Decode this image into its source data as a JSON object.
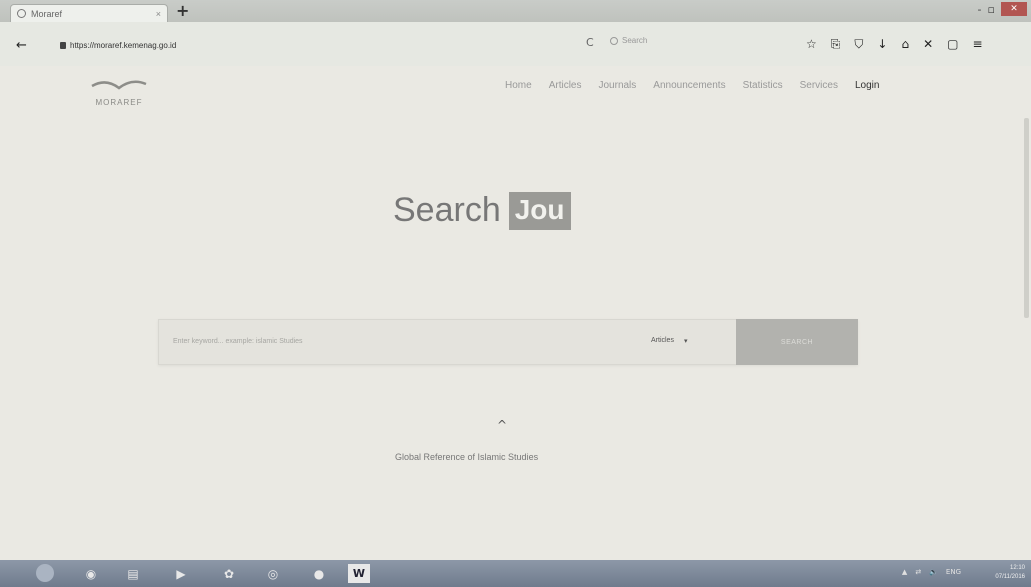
{
  "browser": {
    "tab_title": "Moraref",
    "tab_close": "×",
    "new_tab": "+",
    "window_controls": [
      "-",
      "▫"
    ],
    "back": "←",
    "url": "https://moraref.kemenag.go.id",
    "reload": "C",
    "search_placeholder": "Search",
    "toolbar_icons": [
      "☆",
      "⎘",
      "⛉",
      "↓",
      "⌂",
      "✕",
      "▢",
      "≡"
    ]
  },
  "site": {
    "logo_text": "MORAREF",
    "nav": [
      "Home",
      "Articles",
      "Journals",
      "Announcements",
      "Statistics",
      "Services"
    ],
    "login": "Login",
    "hero_prefix": "Search",
    "hero_highlight": "Jou",
    "search_placeholder": "Enter keyword... example: islamic Studies",
    "search_type": "Articles",
    "search_type_caret": "▾",
    "search_button": "SEARCH",
    "scroll_caret": "^",
    "tagline": "Global Reference of Islamic Studies"
  },
  "taskbar": {
    "word_label": "W",
    "tray": [
      "▲",
      "⇄",
      "🔈",
      "ENG"
    ],
    "clock_time": "12:10",
    "clock_date": "07/11/2016"
  },
  "colors": {
    "hero_badge": "#9a9a96",
    "search_button": "#b2b2ae",
    "taskbar": "#7d889a"
  }
}
